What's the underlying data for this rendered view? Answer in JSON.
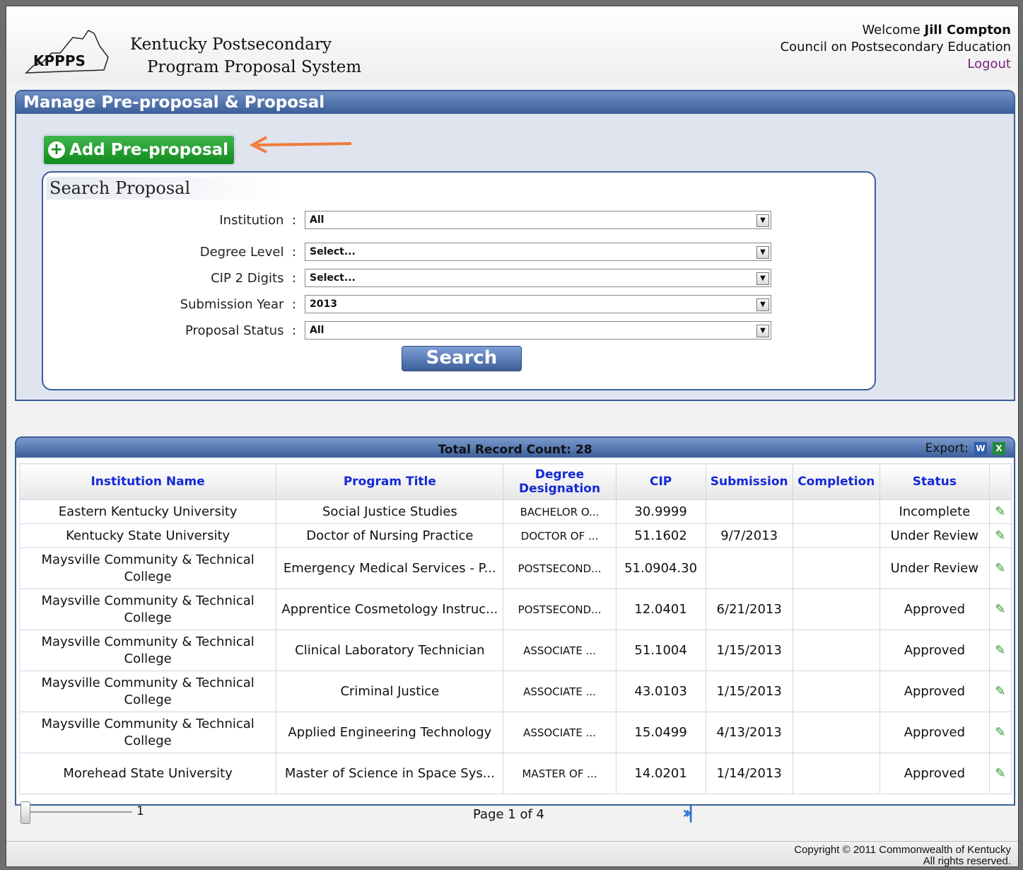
{
  "header": {
    "logo_text": "KPPPS",
    "title_line1": "Kentucky Postsecondary",
    "title_line2": "Program Proposal System",
    "welcome": "Welcome",
    "user_name": "Jill Compton",
    "organization": "Council on Postsecondary Education",
    "logout": "Logout"
  },
  "manage": {
    "title": "Manage Pre-proposal & Proposal",
    "add_button": "Add Pre-proposal"
  },
  "search": {
    "title": "Search Proposal",
    "fields": [
      {
        "label": "Institution",
        "value": "All"
      },
      {
        "label": "Degree Level",
        "value": "Select..."
      },
      {
        "label": "CIP 2 Digits",
        "value": "Select..."
      },
      {
        "label": "Submission Year",
        "value": "2013"
      },
      {
        "label": "Proposal Status",
        "value": "All"
      }
    ],
    "separator": ":",
    "button": "Search"
  },
  "grid": {
    "count_label": "Total Record Count: 28",
    "export_label": "Export:",
    "columns": [
      "Institution Name",
      "Program Title",
      "Degree Designation",
      "CIP",
      "Submission",
      "Completion",
      "Status"
    ],
    "rows": [
      {
        "institution": "Eastern Kentucky University",
        "program": "Social Justice Studies",
        "degree": "BACHELOR O...",
        "cip": "30.9999",
        "submission": "",
        "completion": "",
        "status": "Incomplete"
      },
      {
        "institution": "Kentucky State University",
        "program": "Doctor of Nursing Practice",
        "degree": "DOCTOR OF ...",
        "cip": "51.1602",
        "submission": "9/7/2013",
        "completion": "",
        "status": "Under Review"
      },
      {
        "institution": "Maysville Community & Technical College",
        "program": "Emergency Medical Services - P...",
        "degree": "POSTSECOND...",
        "cip": "51.0904.30",
        "submission": "",
        "completion": "",
        "status": "Under Review"
      },
      {
        "institution": "Maysville Community & Technical College",
        "program": "Apprentice Cosmetology Instruc...",
        "degree": "POSTSECOND...",
        "cip": "12.0401",
        "submission": "6/21/2013",
        "completion": "",
        "status": "Approved"
      },
      {
        "institution": "Maysville Community & Technical College",
        "program": "Clinical Laboratory Technician",
        "degree": "ASSOCIATE ...",
        "cip": "51.1004",
        "submission": "1/15/2013",
        "completion": "",
        "status": "Approved"
      },
      {
        "institution": "Maysville Community & Technical College",
        "program": "Criminal Justice",
        "degree": "ASSOCIATE ...",
        "cip": "43.0103",
        "submission": "1/15/2013",
        "completion": "",
        "status": "Approved"
      },
      {
        "institution": "Maysville Community & Technical College",
        "program": "Applied Engineering Technology",
        "degree": "ASSOCIATE ...",
        "cip": "15.0499",
        "submission": "4/13/2013",
        "completion": "",
        "status": "Approved"
      },
      {
        "institution": "Morehead State University",
        "program": "Master of Science in Space Sys...",
        "degree": "MASTER OF ...",
        "cip": "14.0201",
        "submission": "1/14/2013",
        "completion": "",
        "status": "Approved"
      }
    ]
  },
  "pager": {
    "slider_value": "1",
    "page_info": "Page 1 of 4"
  },
  "footer": {
    "line1": "Copyright © 2011 Commonwealth of Kentucky",
    "line2": "All rights reserved."
  }
}
